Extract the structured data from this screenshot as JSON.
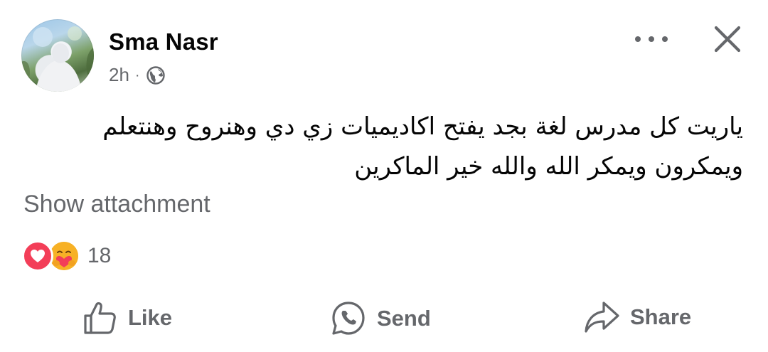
{
  "post": {
    "author": "Sma Nasr",
    "time": "2h",
    "separator": "·",
    "text_line_1": "ياريت كل مدرس لغة بجد يفتح اكاديميات زي دي وهنروح وهنتعلم",
    "text_line_2": "ويمكرون ويمكر الله والله خير الماكرين",
    "show_attachment": "Show attachment",
    "reaction_count": "18",
    "reactions": [
      "love",
      "care"
    ]
  },
  "actions": {
    "like": "Like",
    "send": "Send",
    "share": "Share"
  },
  "icons": {
    "audience": "globe-icon",
    "more": "more-horizontal-icon",
    "close": "close-icon",
    "like": "thumbs-up-icon",
    "send": "whatsapp-icon",
    "share": "share-arrow-icon"
  },
  "colors": {
    "text_primary": "#050505",
    "text_secondary": "#65676b",
    "love": "#f33e58",
    "care": "#f7b125"
  }
}
